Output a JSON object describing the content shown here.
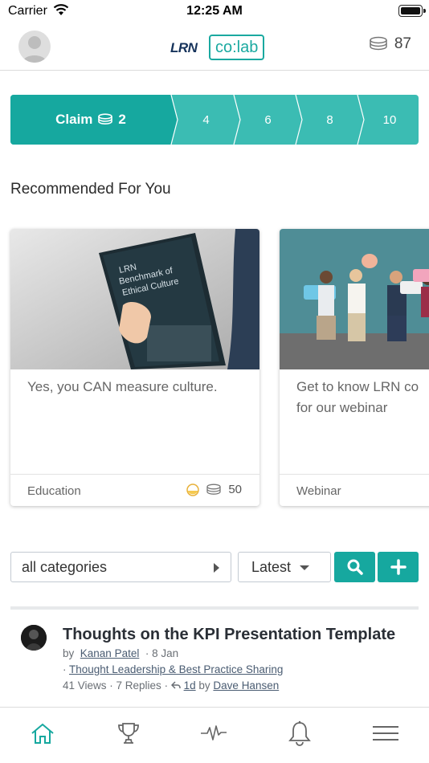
{
  "status_bar": {
    "carrier": "Carrier",
    "time": "12:25 AM"
  },
  "header": {
    "logo_lrn": "LRN",
    "logo_colab": "co:lab",
    "coins": "87"
  },
  "claim_bar": {
    "claim_label": "Claim",
    "claim_value": "2",
    "steps": [
      "4",
      "6",
      "8",
      "10"
    ]
  },
  "recommended": {
    "title": "Recommended For You",
    "cards": [
      {
        "description": "Yes, you CAN measure culture.",
        "category": "Education",
        "points": "50",
        "image_text": "LRN Benchmark of Ethical Culture"
      },
      {
        "description": "Get to know LRN co for our webinar",
        "category": "Webinar"
      }
    ]
  },
  "filters": {
    "category": "all categories",
    "sort": "Latest"
  },
  "post": {
    "title": "Thoughts on the KPI Presentation Template",
    "by": "by",
    "author": "Kanan Patel",
    "date": "· 8 Jan",
    "category_prefix": "·",
    "category": "Thought Leadership & Best Practice Sharing",
    "stats": "41 Views · 7 Replies ·",
    "reply_time": "1d",
    "reply_by": "by",
    "reply_author": "Dave Hansen"
  },
  "tabs": [
    "home-icon",
    "trophy-icon",
    "activity-icon",
    "bell-icon",
    "menu-icon"
  ],
  "colors": {
    "accent": "#16a89f",
    "accent_light": "#3bbcb3",
    "navy": "#16335b"
  }
}
